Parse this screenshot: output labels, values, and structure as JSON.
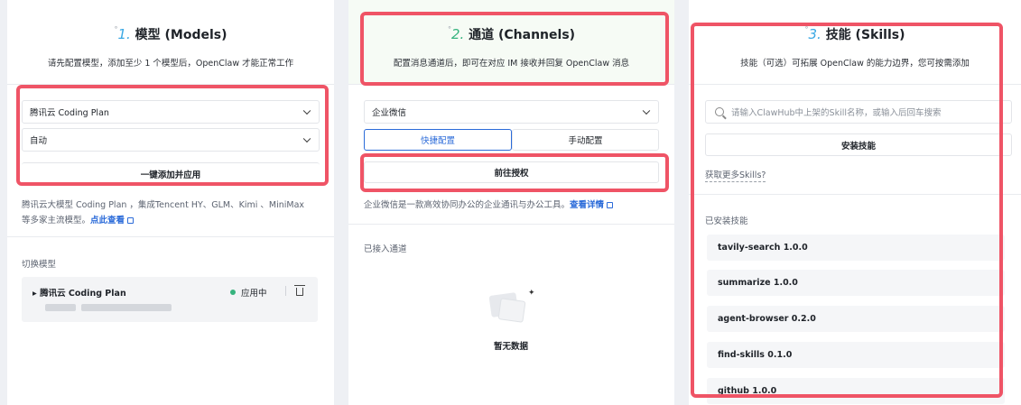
{
  "models": {
    "step_num": "1.",
    "title": "模型 (Models)",
    "desc": "请先配置模型，添加至少 1 个模型后，OpenClaw 才能正常工作",
    "provider_select": "腾讯云 Coding Plan",
    "mode_select": "自动",
    "apply_button": "一键添加并应用",
    "info_text_1": "腾讯云大模型 Coding Plan ，集成Tencent HY、GLM、Kimi 、MiniMax",
    "info_text_2": "等多家主流模型。",
    "info_link": "点此查看",
    "switch_label": "切换模型",
    "current_model": "▸ 腾讯云 Coding Plan",
    "status": "应用中"
  },
  "channels": {
    "step_num": "2.",
    "title": "通道 (Channels)",
    "desc": "配置消息通道后，即可在对应 IM 接收并回复 OpenClaw 消息",
    "channel_select": "企业微信",
    "tab_quick": "快捷配置",
    "tab_manual": "手动配置",
    "auth_button": "前往授权",
    "info_text": "企业微信是一款高效协同办公的企业通讯与办公工具。",
    "info_link": "查看详情",
    "connected_label": "已接入通道",
    "empty_text": "暂无数据"
  },
  "skills": {
    "step_num": "3.",
    "title": "技能 (Skills)",
    "desc": "技能（可选）可拓展 OpenClaw 的能力边界，您可按需添加",
    "search_placeholder": "请输入ClawHub中上架的Skill名称，或输入后回车搜索",
    "install_button": "安装技能",
    "more_link": "获取更多Skills?",
    "installed_label": "已安装技能",
    "items": [
      "tavily-search 1.0.0",
      "summarize 1.0.0",
      "agent-browser 0.2.0",
      "find-skills 0.1.0",
      "github 1.0.0"
    ]
  },
  "colors": {
    "highlight": "#ef5466",
    "link": "#2b6bd9",
    "status": "#36b37e"
  }
}
